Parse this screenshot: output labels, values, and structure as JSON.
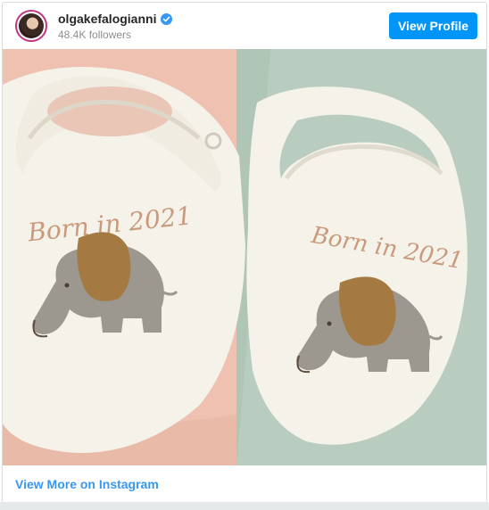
{
  "post": {
    "username": "olgakefalogianni",
    "followers": "48.4K followers",
    "view_profile_label": "View Profile",
    "view_more_label": "View More on Instagram"
  },
  "image": {
    "left_bib_text": "Born in 2021",
    "right_bib_text": "Born in 2021"
  },
  "colors": {
    "accent": "#0095f6",
    "link": "#3897f0",
    "left_fabric": "#eec1b0",
    "right_fabric": "#b8cdbf",
    "bib": "#f5f2ea",
    "elephant": "#9c978f",
    "ear": "#a57a42"
  },
  "icons": {
    "verified": "verified-badge-icon"
  }
}
